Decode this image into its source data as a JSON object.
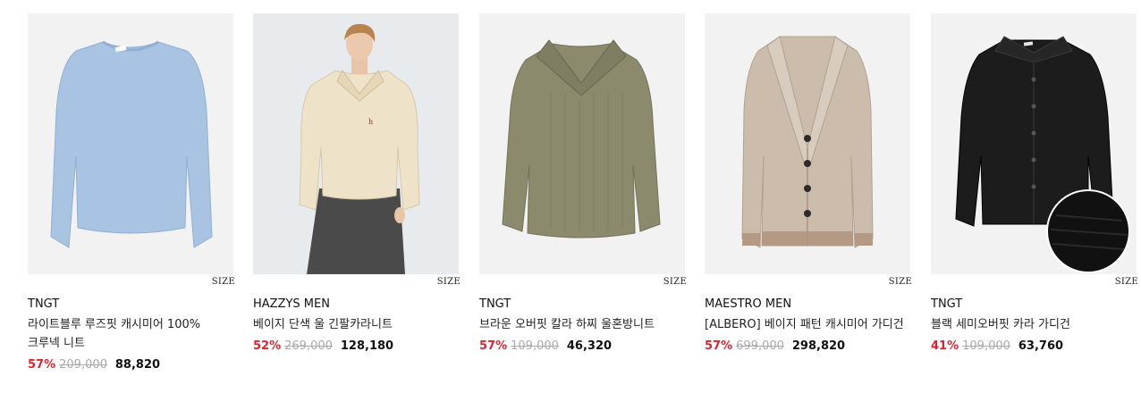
{
  "size_label": "SIZE",
  "products": [
    {
      "brand": "TNGT",
      "name": "라이트블루 루즈핏 캐시미어 100% 크루넥 니트",
      "discount": "57%",
      "original_price": "209,000",
      "sale_price": "88,820",
      "color": "#a9c4e2"
    },
    {
      "brand": "HAZZYS MEN",
      "name": "베이지 단색 울 긴팔카라니트",
      "discount": "52%",
      "original_price": "269,000",
      "sale_price": "128,180",
      "color": "#eee2c8"
    },
    {
      "brand": "TNGT",
      "name": "브라운 오버핏 칼라 하찌 울혼방니트",
      "discount": "57%",
      "original_price": "109,000",
      "sale_price": "46,320",
      "color": "#8c8a6c"
    },
    {
      "brand": "MAESTRO MEN",
      "name": "[ALBERO] 베이지 패턴 캐시미어 가디건",
      "discount": "57%",
      "original_price": "699,000",
      "sale_price": "298,820",
      "color": "#cbbcac"
    },
    {
      "brand": "TNGT",
      "name": "블랙 세미오버핏 카라 가디건",
      "discount": "41%",
      "original_price": "109,000",
      "sale_price": "63,760",
      "color": "#1c1c1c"
    }
  ]
}
